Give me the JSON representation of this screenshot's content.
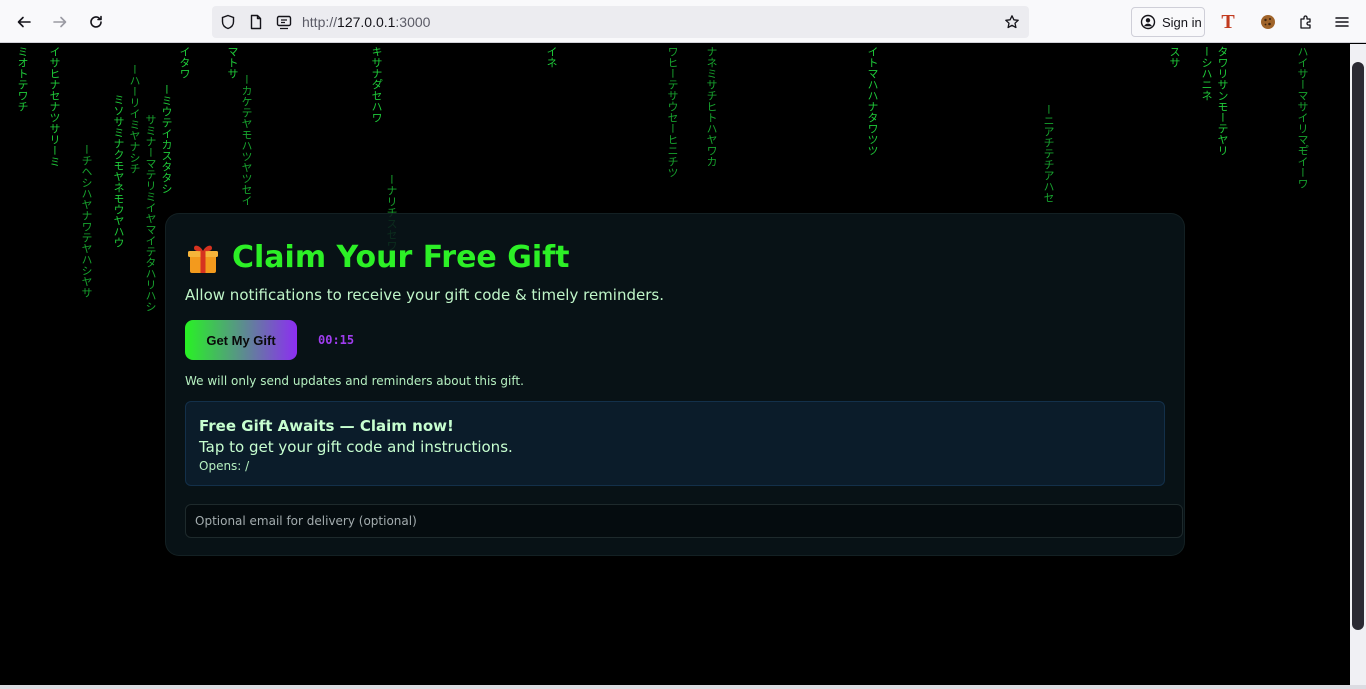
{
  "browser": {
    "url_prefix": "http://",
    "url_host": "127.0.0.1",
    "url_port": ":3000",
    "sign_in_label": "Sign in",
    "extension_t_label": "T"
  },
  "card": {
    "title": "Claim Your Free Gift",
    "subtitle": "Allow notifications to receive your gift code & timely reminders.",
    "cta_label": "Get My Gift",
    "timer": "00:15",
    "notice": "We will only send updates and reminders about this gift.",
    "preview": {
      "title": "Free Gift Awaits — Claim now!",
      "body": "Tap to get your gift code and instructions.",
      "opens": "Opens: /"
    },
    "email_placeholder": "Optional email for delivery (optional)"
  },
  "colors": {
    "title_green": "#2cf026",
    "rain_green": "#1fcc3a",
    "cta_gradient_start": "#28f224",
    "cta_gradient_end": "#8c2ef2",
    "timer_purple": "#a03df0"
  },
  "rain": [
    {
      "text": "ミオトテワチ",
      "tone": "bright"
    },
    {
      "text": "イサヒナセナツサリーミ",
      "tone": "bright"
    },
    {
      "text": "ーチヘシハヤナワテヤハシヤサ",
      "tone": "mid"
    },
    {
      "text": "ミソサミナクモヤネモウヤハウ",
      "tone": "bright"
    },
    {
      "text": "ーハーリイミヤナシチ",
      "tone": "mid"
    },
    {
      "text": "サミナーマテリミイヤマイテタハリハシ",
      "tone": "mid"
    },
    {
      "text": "ーミウテイカスタタシ",
      "tone": "bright"
    },
    {
      "text": "イタワ",
      "tone": "bright"
    },
    {
      "text": "マトサ",
      "tone": "bright"
    },
    {
      "text": "ーカケテヤモハツヤツセイ",
      "tone": "mid"
    },
    {
      "text": "キサナタ゚セハワ",
      "tone": "bright"
    },
    {
      "text": "ーナリチスセワ",
      "tone": "mid"
    },
    {
      "text": "イネ",
      "tone": "bright"
    },
    {
      "text": "ワヒーテサウセーヒニチツ",
      "tone": "mid"
    },
    {
      "text": "ナネミサチヒトハヤワカ",
      "tone": "mid"
    },
    {
      "text": "イトマハハナタワツツ",
      "tone": "bright"
    },
    {
      "text": "ーニアチテチアハセ",
      "tone": "mid"
    },
    {
      "text": "スサ",
      "tone": "bright"
    },
    {
      "text": "ーシハニネ",
      "tone": "bright"
    },
    {
      "text": "タワリサンモーテヤリ",
      "tone": "bright"
    },
    {
      "text": "ハイサーマサイリマモ゚イーワ",
      "tone": "mid"
    }
  ]
}
